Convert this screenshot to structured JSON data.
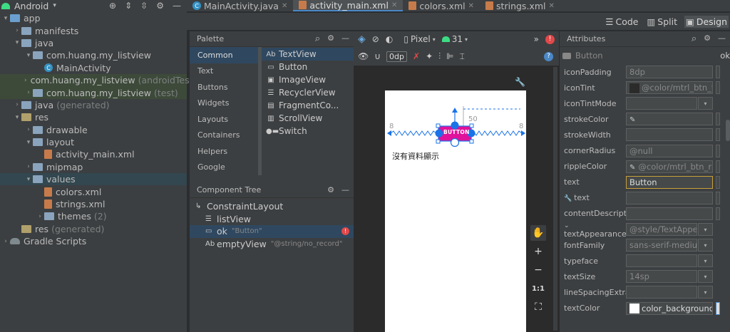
{
  "project": {
    "view_label": "Android",
    "items": [
      {
        "label": "app",
        "indent": 0,
        "arrow": "▾",
        "kind": "folder-blue"
      },
      {
        "label": "manifests",
        "indent": 1,
        "arrow": "›",
        "kind": "folder"
      },
      {
        "label": "java",
        "indent": 1,
        "arrow": "▾",
        "kind": "folder"
      },
      {
        "label": "com.huang.my_listview",
        "indent": 2,
        "arrow": "▾",
        "kind": "folder"
      },
      {
        "label": "MainActivity",
        "indent": 3,
        "arrow": "",
        "kind": "class"
      },
      {
        "label": "com.huang.my_listview",
        "suffix": "(androidTest)",
        "indent": 2,
        "arrow": "›",
        "kind": "folder",
        "green": true
      },
      {
        "label": "com.huang.my_listview",
        "suffix": "(test)",
        "indent": 2,
        "arrow": "›",
        "kind": "folder",
        "green": true
      },
      {
        "label": "java",
        "suffix": "(generated)",
        "indent": 1,
        "arrow": "›",
        "kind": "folder"
      },
      {
        "label": "res",
        "indent": 1,
        "arrow": "▾",
        "kind": "folder-tan"
      },
      {
        "label": "drawable",
        "indent": 2,
        "arrow": "›",
        "kind": "folder"
      },
      {
        "label": "layout",
        "indent": 2,
        "arrow": "▾",
        "kind": "folder"
      },
      {
        "label": "activity_main.xml",
        "indent": 3,
        "arrow": "",
        "kind": "xml"
      },
      {
        "label": "mipmap",
        "indent": 2,
        "arrow": "›",
        "kind": "folder"
      },
      {
        "label": "values",
        "indent": 2,
        "arrow": "▾",
        "kind": "folder",
        "selected": true
      },
      {
        "label": "colors.xml",
        "indent": 3,
        "arrow": "",
        "kind": "xml"
      },
      {
        "label": "strings.xml",
        "indent": 3,
        "arrow": "",
        "kind": "xml"
      },
      {
        "label": "themes",
        "suffix": "(2)",
        "indent": 3,
        "arrow": "›",
        "kind": "folder"
      },
      {
        "label": "res",
        "suffix": "(generated)",
        "indent": 1,
        "arrow": "",
        "kind": "folder-tan"
      },
      {
        "label": "Gradle Scripts",
        "indent": 0,
        "arrow": "›",
        "kind": "gradle"
      }
    ]
  },
  "tabs": [
    {
      "label": "MainActivity.java",
      "icon": "class-icon",
      "active": false
    },
    {
      "label": "activity_main.xml",
      "icon": "xml-icon",
      "active": true
    },
    {
      "label": "colors.xml",
      "icon": "xml-icon",
      "active": false
    },
    {
      "label": "strings.xml",
      "icon": "xml-icon",
      "active": false
    }
  ],
  "view_switch": {
    "code": "Code",
    "split": "Split",
    "design": "Design"
  },
  "palette": {
    "title": "Palette",
    "categories": [
      "Common",
      "Text",
      "Buttons",
      "Widgets",
      "Layouts",
      "Containers",
      "Helpers",
      "Google"
    ],
    "items": [
      {
        "label": "TextView",
        "icon": "Ab"
      },
      {
        "label": "Button",
        "icon": "btn"
      },
      {
        "label": "ImageView",
        "icon": "img"
      },
      {
        "label": "RecyclerView",
        "icon": "list"
      },
      {
        "label": "FragmentCo...",
        "icon": "frag"
      },
      {
        "label": "ScrollView",
        "icon": "scroll"
      },
      {
        "label": "Switch",
        "icon": "switch"
      }
    ]
  },
  "component_tree": {
    "title": "Component Tree",
    "rows": [
      {
        "label": "ConstraintLayout",
        "sub": "",
        "indent": 0,
        "icon": "constraint-icon"
      },
      {
        "label": "listView",
        "sub": "",
        "indent": 1,
        "icon": "list-icon"
      },
      {
        "label": "ok",
        "sub": "\"Button\"",
        "indent": 1,
        "icon": "button-icon",
        "selected": true,
        "error": true
      },
      {
        "label": "emptyView",
        "sub": "\"@string/no_record\"",
        "indent": 1,
        "icon": "text-icon"
      }
    ]
  },
  "design_toolbar": {
    "device": "Pixel",
    "api": "31",
    "margin": "0dp"
  },
  "canvas": {
    "button_text": "BUTTON",
    "empty_text": "沒有資料顯示",
    "left_margin": "8",
    "right_margin": "8",
    "top_margin": "50"
  },
  "attributes": {
    "title": "Attributes",
    "component": "Button",
    "component_id": "ok",
    "rows": [
      {
        "label": "iconPadding",
        "value": "8dp",
        "type": "text"
      },
      {
        "label": "iconTint",
        "value": "@color/mtrl_btn_te",
        "type": "swatch",
        "swatch": "#2b2b2b"
      },
      {
        "label": "iconTintMode",
        "value": "",
        "type": "dropdown"
      },
      {
        "label": "strokeColor",
        "value": "",
        "type": "picker"
      },
      {
        "label": "strokeWidth",
        "value": "",
        "type": "text"
      },
      {
        "label": "cornerRadius",
        "value": "@null",
        "type": "text"
      },
      {
        "label": "rippleColor",
        "value": "@color/mtrl_btn_rip",
        "type": "picker"
      },
      {
        "label": "text",
        "value": "Button",
        "type": "text-active"
      },
      {
        "label": "text",
        "value": "",
        "type": "tool-text"
      },
      {
        "label": "contentDescripti...",
        "value": "",
        "type": "text"
      },
      {
        "label": "textAppearance",
        "value": "@style/TextAppe:",
        "type": "dropdown-arrow"
      },
      {
        "label": "fontFamily",
        "value": "sans-serif-mediur",
        "type": "dropdown"
      },
      {
        "label": "typeface",
        "value": "",
        "type": "dropdown"
      },
      {
        "label": "textSize",
        "value": "14sp",
        "type": "dropdown"
      },
      {
        "label": "lineSpacingExtra",
        "value": "",
        "type": "dropdown"
      },
      {
        "label": "textColor",
        "value": "color_background",
        "type": "swatch-white"
      }
    ]
  },
  "colors": {
    "accent": "#4a88c7",
    "selection": "#2f4860",
    "error": "#e0494b",
    "android_green": "#3ddc84",
    "button_magenta": "#e0129b",
    "handle_blue": "#1a73e8"
  }
}
